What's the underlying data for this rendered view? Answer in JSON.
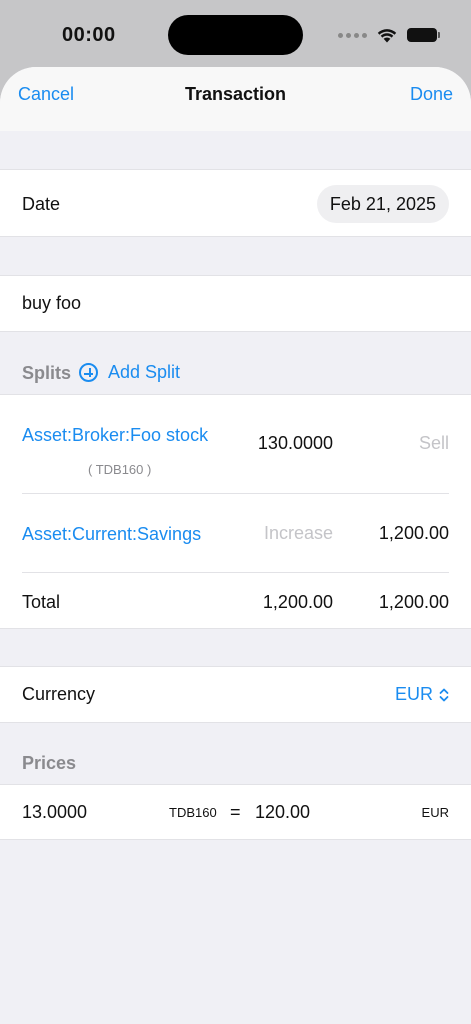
{
  "status": {
    "time": "00:00"
  },
  "nav": {
    "cancel": "Cancel",
    "title": "Transaction",
    "done": "Done"
  },
  "date": {
    "label": "Date",
    "value": "Feb 21, 2025"
  },
  "description": {
    "value": "buy foo"
  },
  "splits": {
    "header": "Splits",
    "add_label": "Add Split",
    "rows": [
      {
        "account": "Asset:Broker:Foo stock",
        "sub": "( TDB160 )",
        "amount": "130.0000",
        "action": "Sell"
      },
      {
        "account": "Asset:Current:Savings",
        "action": "Increase",
        "amount": "1,200.00"
      }
    ],
    "total": {
      "label": "Total",
      "debit": "1,200.00",
      "credit": "1,200.00"
    }
  },
  "currency": {
    "label": "Currency",
    "value": "EUR"
  },
  "prices": {
    "header": "Prices",
    "amount": "13.0000",
    "commodity": "TDB160",
    "equals": "=",
    "value": "120.00",
    "currency": "EUR"
  },
  "colors": {
    "accent": "#1a8cf0",
    "background": "#f0f0f5",
    "muted": "#c4c4c8"
  }
}
